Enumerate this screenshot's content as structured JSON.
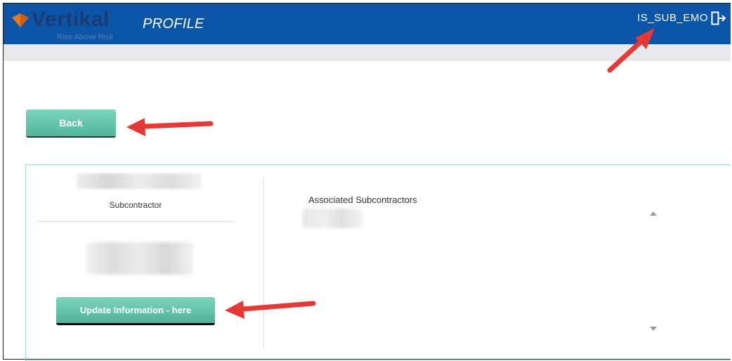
{
  "header": {
    "brand": "Vertikal",
    "tagline": "Rise Above Risk",
    "page_title": "PROFILE",
    "username": "IS_SUB_EMO",
    "logout_icon": "logout-icon"
  },
  "actions": {
    "back_label": "Back",
    "update_label": "Update Information - here"
  },
  "profile": {
    "role": "Subcontractor"
  },
  "associated": {
    "title": "Associated Subcontractors"
  },
  "colors": {
    "header_bg": "#0b55a8",
    "button_teal": "#5fc2a6",
    "annotation_red": "#e53935"
  }
}
